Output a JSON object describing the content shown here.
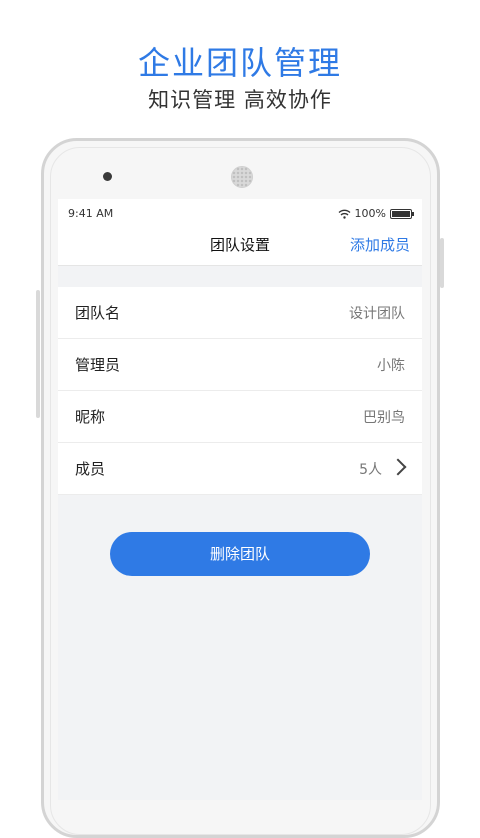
{
  "promo": {
    "title": "企业团队管理",
    "subtitle": "知识管理 高效协作"
  },
  "status_bar": {
    "time": "9:41 AM",
    "battery": "100%",
    "icons": [
      "wifi-icon",
      "battery-icon"
    ]
  },
  "nav": {
    "title": "团队设置",
    "action_label": "添加成员"
  },
  "team_info": {
    "rows": [
      {
        "label": "团队名",
        "value": "设计团队"
      },
      {
        "label": "管理员",
        "value": "小陈"
      },
      {
        "label": "昵称",
        "value": "巴别鸟"
      },
      {
        "label": "成员",
        "value": "5人",
        "icon": "chevron-right-icon"
      }
    ]
  },
  "actions": {
    "delete_label": "删除团队"
  },
  "colors": {
    "accent": "#2f7ae5",
    "background": "#f2f3f5"
  }
}
